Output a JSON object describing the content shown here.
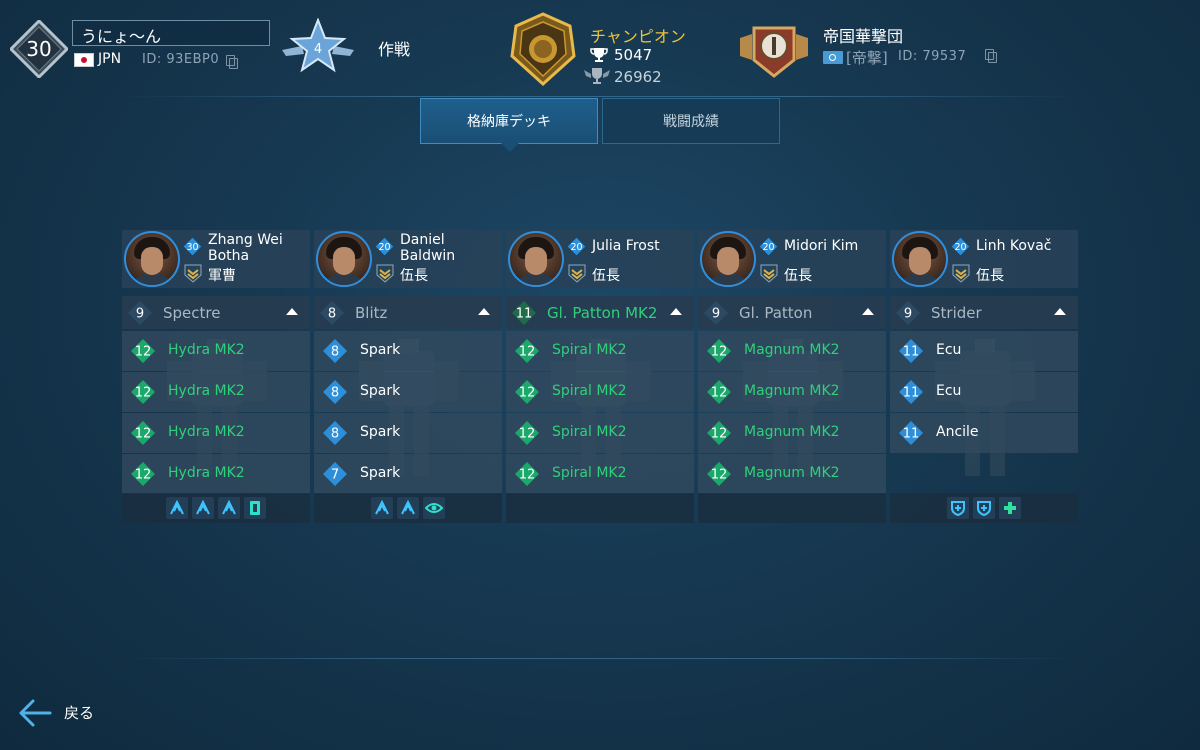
{
  "player": {
    "level": "30",
    "name": "うにょ〜ん",
    "country": "JPN",
    "id": "ID: 93EBP0",
    "operations_rank": "4",
    "operations_label": "作戦"
  },
  "league": {
    "name": "チャンピオン",
    "trophies": "5047",
    "total_trophies": "26962"
  },
  "clan": {
    "name": "帝国華撃団",
    "tag": "[帝撃]",
    "id": "ID: 79537"
  },
  "tabs": {
    "hangar": "格納庫デッキ",
    "stats": "戦闘成績"
  },
  "colors": {
    "green_level": "#1aa86b",
    "blue_level": "#2d8fd9",
    "gold": "#f0c23b"
  },
  "columns": [
    {
      "pilot": {
        "name": "Zhang Wei Botha",
        "level": "30",
        "rank": "軍曹"
      },
      "robot": {
        "name": "Spectre",
        "level": "9"
      },
      "weapons": [
        {
          "level": "12",
          "name": "Hydra MK2"
        },
        {
          "level": "12",
          "name": "Hydra MK2"
        },
        {
          "level": "12",
          "name": "Hydra MK2"
        },
        {
          "level": "12",
          "name": "Hydra MK2"
        }
      ]
    },
    {
      "pilot": {
        "name": "Daniel Baldwin",
        "level": "20",
        "rank": "伍長"
      },
      "robot": {
        "name": "Blitz",
        "level": "8"
      },
      "weapons": [
        {
          "level": "8",
          "name": "Spark"
        },
        {
          "level": "8",
          "name": "Spark"
        },
        {
          "level": "8",
          "name": "Spark"
        },
        {
          "level": "7",
          "name": "Spark"
        }
      ]
    },
    {
      "pilot": {
        "name": "Julia Frost",
        "level": "20",
        "rank": "伍長"
      },
      "robot": {
        "name": "Gl. Patton MK2",
        "level": "11"
      },
      "weapons": [
        {
          "level": "12",
          "name": "Spiral MK2"
        },
        {
          "level": "12",
          "name": "Spiral MK2"
        },
        {
          "level": "12",
          "name": "Spiral MK2"
        },
        {
          "level": "12",
          "name": "Spiral MK2"
        }
      ]
    },
    {
      "pilot": {
        "name": "Midori Kim",
        "level": "20",
        "rank": "伍長"
      },
      "robot": {
        "name": "Gl. Patton",
        "level": "9"
      },
      "weapons": [
        {
          "level": "12",
          "name": "Magnum MK2"
        },
        {
          "level": "12",
          "name": "Magnum MK2"
        },
        {
          "level": "12",
          "name": "Magnum MK2"
        },
        {
          "level": "12",
          "name": "Magnum MK2"
        }
      ]
    },
    {
      "pilot": {
        "name": "Linh Kovač",
        "level": "20",
        "rank": "伍長"
      },
      "robot": {
        "name": "Strider",
        "level": "9"
      },
      "weapons": [
        {
          "level": "11",
          "name": "Ecu"
        },
        {
          "level": "11",
          "name": "Ecu"
        },
        {
          "level": "11",
          "name": "Ancile"
        }
      ]
    }
  ],
  "footer": {
    "back_label": "戻る"
  }
}
